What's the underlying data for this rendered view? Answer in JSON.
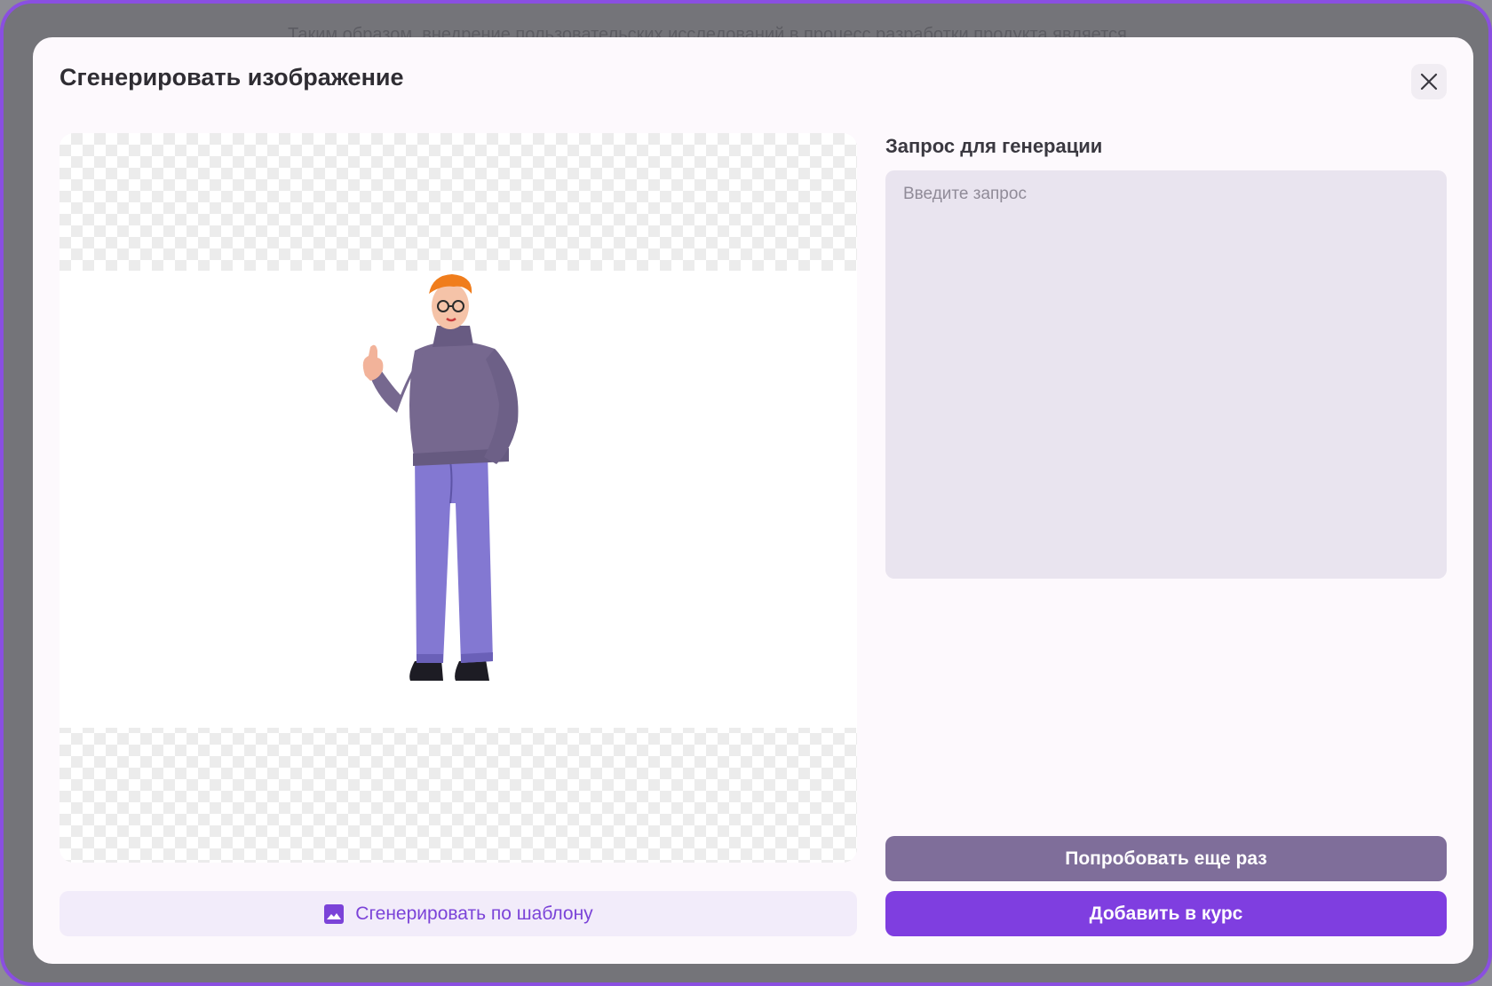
{
  "background": {
    "text": "Таким образом, внедрение пользовательских исследований в процесс разработки продукта является"
  },
  "modal": {
    "title": "Сгенерировать изображение",
    "close_icon": "close-icon"
  },
  "preview": {
    "image_description_icon": "person-thumbs-up-illustration"
  },
  "template_button": {
    "label": "Сгенерировать по шаблону",
    "icon": "image-icon"
  },
  "prompt": {
    "label": "Запрос для генерации",
    "placeholder": "Введите запрос",
    "value": ""
  },
  "actions": {
    "retry_label": "Попробовать еще раз",
    "add_label": "Добавить в курс"
  },
  "colors": {
    "accent": "#7f3ee0",
    "secondary_button": "#7f6e9a",
    "frame_border": "#8a4fe0"
  }
}
